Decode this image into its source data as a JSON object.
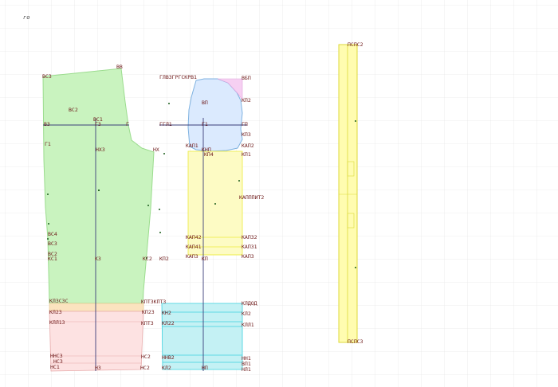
{
  "origin_label": "го",
  "colors": {
    "grid": "#e8e8e8",
    "construction": "#3b3f7a",
    "label": "#6e1a1a",
    "back": "#c9f3bf",
    "back_stroke": "#9bdc8e",
    "sleeve": "#dbeafe",
    "sleeve_stroke": "#7fb2e0",
    "pink": "#f6d0f2",
    "yellow": "#fdfbc4",
    "yellow_stroke": "#eceb3c",
    "red": "#fde2e2",
    "red_stroke": "#e7aaaa",
    "cyan": "#c4f1f4",
    "cyan_stroke": "#3cd1de",
    "orange": "#fbe3bf",
    "strip": "#fffcb0",
    "strip_stroke": "#dcd93a"
  },
  "labels": {
    "b63": "ВС3",
    "vb": "ВВ",
    "b32": "ВС2",
    "b31a": "ВС1",
    "b3": "ВЗ",
    "g3": "Г3",
    "g": "Г",
    "g31": "Г1",
    "nh3": "НХ3",
    "nh": "НХ",
    "b34": "ВС4",
    "b33": "ВС3",
    "b32b": "ВС2",
    "k31": "КС1",
    "k3": "К3",
    "k32": "КС2",
    "kp2": "КП2",
    "k2c": "КЛЗС3С",
    "k223": "КПТ3КПТ3",
    "kl23": "КЛ23",
    "kp23": "КП23",
    "kl13": "КЛЛ13",
    "kp223": "КПТ3",
    "nh31": "ННС3",
    "n31": "НС3",
    "h31": "НС1",
    "h32": "НС2",
    "h3": "Н3",
    "h32b": "НС2",
    "glb": "ГЛВЗГРГСКРВ1",
    "vp": "ВП",
    "vbp": "ВБП",
    "kp2r": "КП2",
    "gp": "ГП",
    "g1": "ГГЛ1",
    "g1b": "Г1",
    "kp3": "КП3",
    "kap1": "КАП1",
    "knp": "КНП",
    "kap2": "КАП2",
    "kp4": "КП4",
    "kp1": "КП1",
    "kapp": "КАПППИТ2",
    "kap42": "КАП42",
    "kap32": "КАП32",
    "kap41": "КАП41",
    "kap31": "КАП31",
    "kap3": "КАП3",
    "kn": "КП",
    "kapr": "КАП3",
    "kn2": "КН2",
    "kl2": "КЛ2",
    "kl22": "КЛ22",
    "kl1": "КЛ1",
    "kll1": "КЛЛ1",
    "nn2": "ННВ2",
    "nn": "НП",
    "hn1": "НН1",
    "nl1": "НЛ1",
    "vn1": "ВП1",
    "kladd": "КЛДОД",
    "pcpc2": "ПСПС2",
    "pcpc3": "ПСПС3"
  }
}
